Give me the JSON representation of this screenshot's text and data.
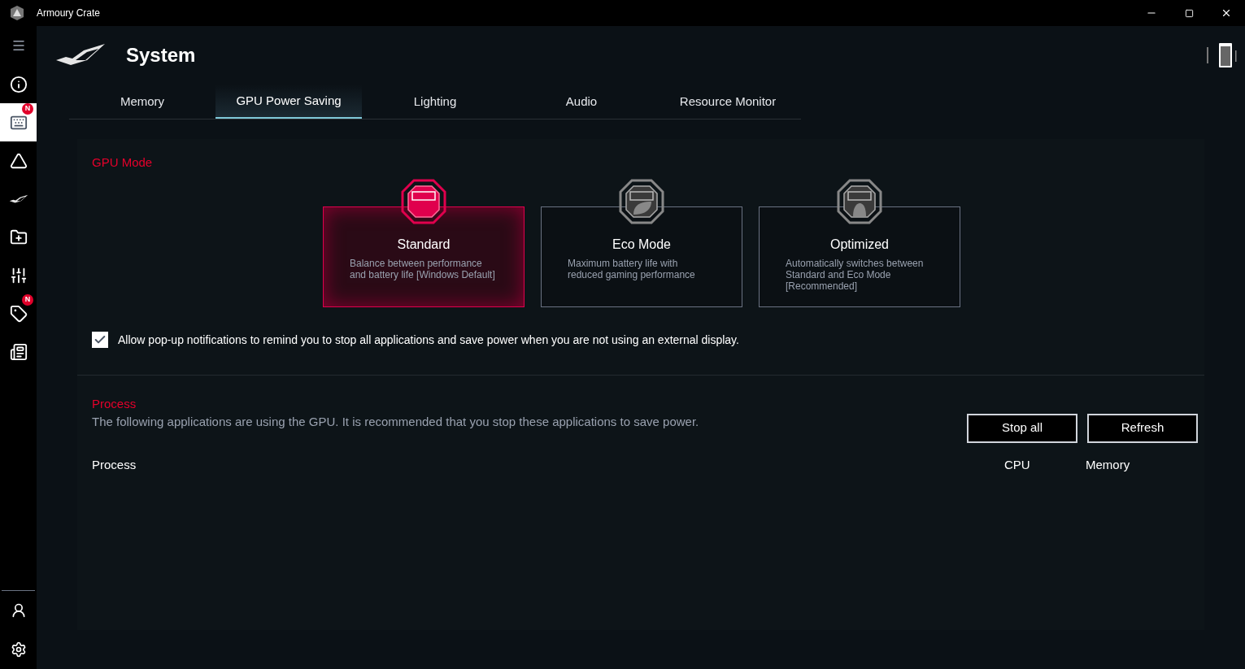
{
  "window": {
    "title": "Armoury Crate"
  },
  "sidebar": {
    "items": [
      {
        "kind": "info",
        "selected": false
      },
      {
        "kind": "devices",
        "selected": true,
        "badge": "N"
      },
      {
        "kind": "triangle",
        "selected": false
      },
      {
        "kind": "rog",
        "selected": false
      },
      {
        "kind": "library",
        "selected": false
      },
      {
        "kind": "sliders",
        "selected": false
      },
      {
        "kind": "deals",
        "selected": false,
        "badge": "N"
      },
      {
        "kind": "news",
        "selected": false
      }
    ]
  },
  "page": {
    "title": "System"
  },
  "tabs": [
    {
      "label": "Memory",
      "selected": false
    },
    {
      "label": "GPU Power Saving",
      "selected": true
    },
    {
      "label": "Lighting",
      "selected": false
    },
    {
      "label": "Audio",
      "selected": false
    },
    {
      "label": "Resource Monitor",
      "selected": false
    }
  ],
  "gpu_mode": {
    "heading": "GPU Mode",
    "modes": [
      {
        "kind": "standard",
        "name": "Standard",
        "description": "Balance between performance and battery life [Windows Default]",
        "selected": true
      },
      {
        "kind": "eco",
        "name": "Eco Mode",
        "description": "Maximum battery life with reduced gaming performance",
        "selected": false
      },
      {
        "kind": "optimized",
        "name": "Optimized",
        "description": "Automatically switches between Standard and Eco Mode [Recommended]",
        "selected": false
      }
    ],
    "notification": {
      "label": "Allow pop-up notifications to remind you to stop all applications and save power when you are not using an external display.",
      "checked": true
    }
  },
  "process": {
    "heading": "Process",
    "description": "The following applications are using the GPU. It is recommended that you stop these applications to save power.",
    "buttons": [
      "Stop all",
      "Refresh"
    ],
    "columns": [
      "Process",
      "CPU",
      "Memory"
    ]
  }
}
